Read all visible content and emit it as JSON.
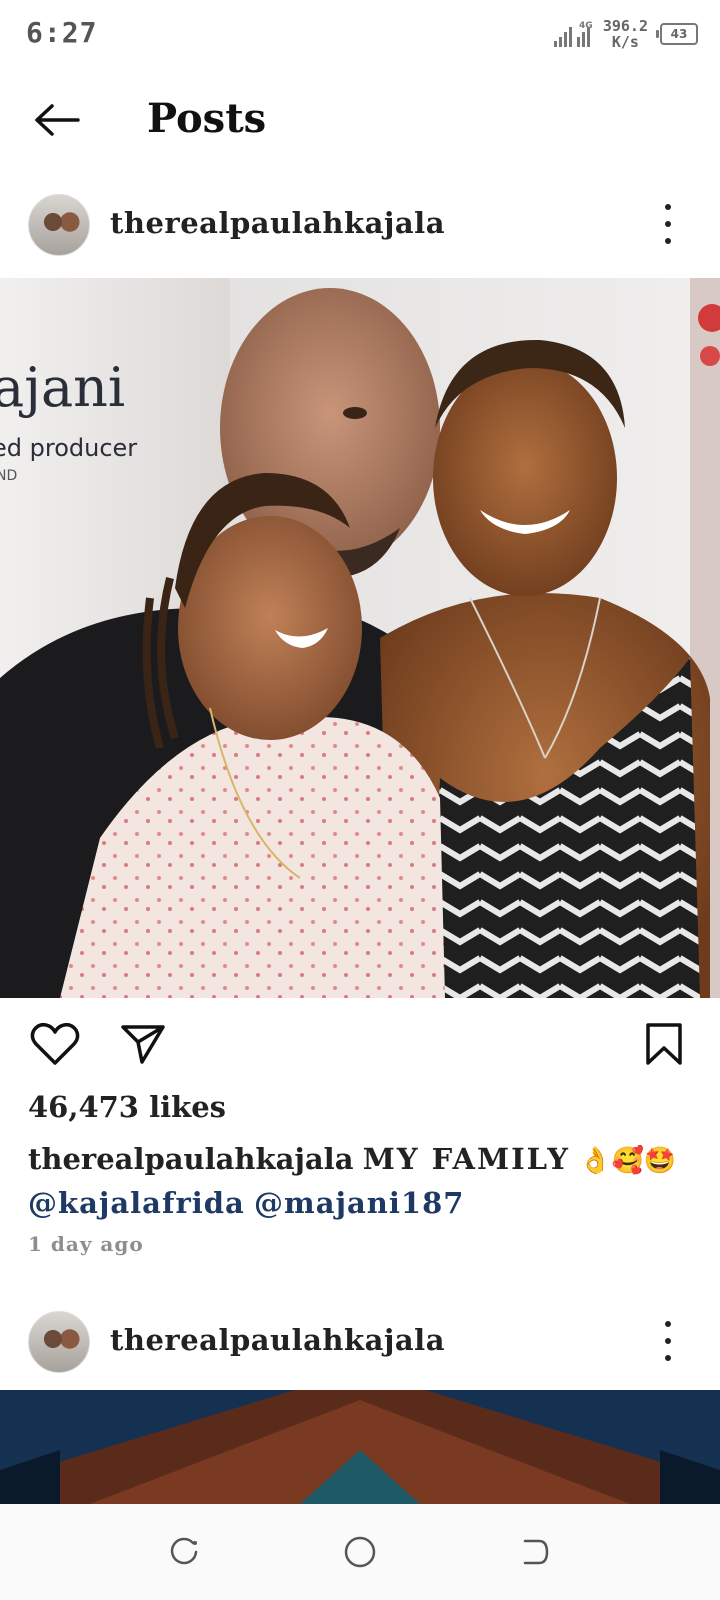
{
  "status_bar": {
    "time": "6:27",
    "network_type": "4G",
    "speed_value": "396.2",
    "speed_unit": "K/s",
    "battery": "43"
  },
  "header": {
    "title": "Posts",
    "back_icon": "arrow-left-icon"
  },
  "posts": [
    {
      "username": "therealpaulahkajala",
      "image_description_icon": "photo",
      "likes": "46,473 likes",
      "caption_user": "therealpaulahkajala",
      "caption_text": "MY FAMILY",
      "caption_emojis": "👌🥰🤩",
      "mentions": [
        "@kajalafrida",
        "@majani187"
      ],
      "time_ago": "1 day ago",
      "magazine_text_1": "ajani",
      "magazine_text_2": "ed producer",
      "magazine_text_3": "ND"
    },
    {
      "username": "therealpaulahkajala"
    }
  ],
  "icons": {
    "like": "heart-icon",
    "share": "send-icon",
    "save": "bookmark-icon",
    "more": "more-vertical-icon"
  },
  "nav": {
    "recents": "recents-icon",
    "home": "home-icon",
    "back": "back-icon"
  }
}
